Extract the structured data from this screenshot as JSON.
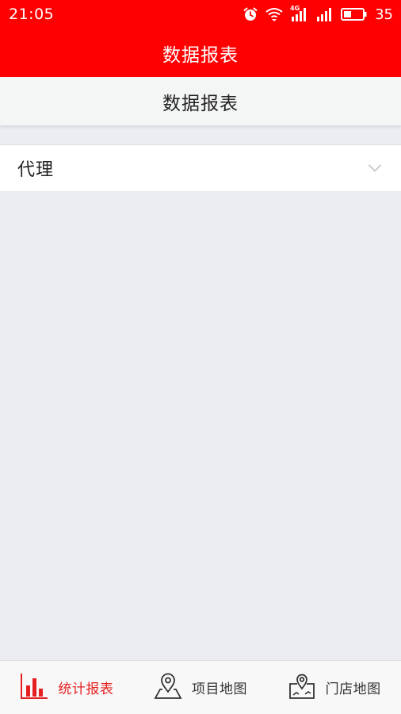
{
  "status_bar": {
    "time": "21:05",
    "network_label": "4G",
    "battery_level": "35",
    "icons": [
      "alarm-icon",
      "wifi-icon",
      "cellular-4g-icon",
      "cellular-signal-icon",
      "battery-icon"
    ]
  },
  "app_bar": {
    "title": "数据报表"
  },
  "section": {
    "title": "数据报表"
  },
  "filter": {
    "selected": "代理",
    "icon": "chevron-down-icon"
  },
  "tabs": [
    {
      "label": "统计报表",
      "icon": "bar-chart-icon",
      "active": true
    },
    {
      "label": "项目地图",
      "icon": "map-pin-icon",
      "active": false
    },
    {
      "label": "门店地图",
      "icon": "store-map-icon",
      "active": false
    }
  ],
  "colors": {
    "primary": "#ff0000",
    "active_tab": "#e62020",
    "background": "#ecedf1",
    "text": "#222222"
  }
}
